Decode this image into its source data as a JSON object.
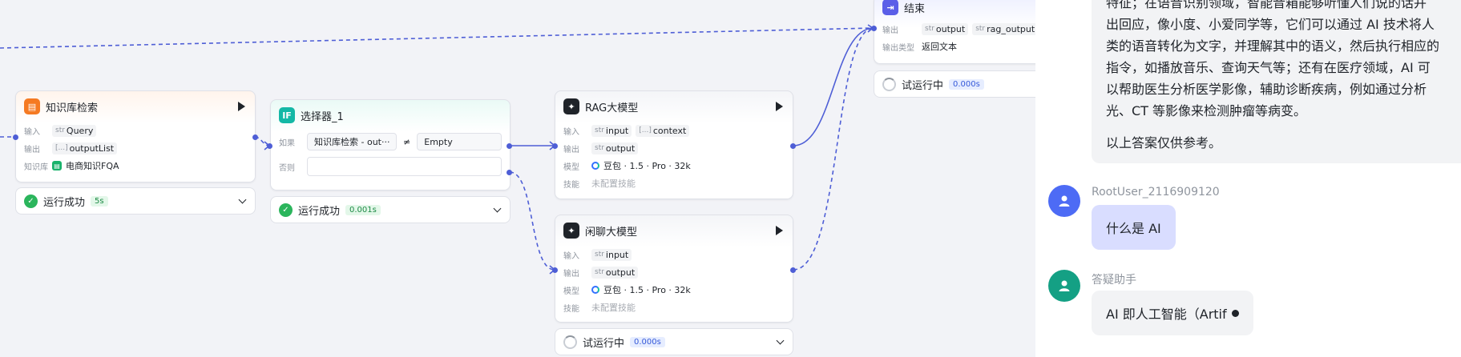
{
  "colors": {
    "edge": "#4e5ed6",
    "success": "#2bb55c",
    "accent": "#3370ff",
    "user_bubble": "#d9ddff"
  },
  "nodes": {
    "kb_search": {
      "title": "知识库检索",
      "input_label": "输入",
      "input_type": "str",
      "input_var": "Query",
      "output_label": "输出",
      "output_type": "[...]",
      "output_var": "outputList",
      "kb_label": "知识库",
      "kb_name": "电商知识FQA",
      "status_text": "运行成功",
      "status_time": "5s"
    },
    "selector": {
      "title": "选择器_1",
      "if_label": "如果",
      "cond_left": "知识库检索 - out···",
      "cond_op": "≠",
      "cond_right": "Empty",
      "else_label": "否则",
      "status_text": "运行成功",
      "status_time": "0.001s"
    },
    "rag_llm": {
      "title": "RAG大模型",
      "input_label": "输入",
      "input_type": "str",
      "input_var": "input",
      "input2_type": "[...]",
      "input2_var": "context",
      "output_label": "输出",
      "output_type": "str",
      "output_var": "output",
      "model_label": "模型",
      "model_name": "豆包 · 1.5 · Pro · 32k",
      "skill_label": "技能",
      "skill_value": "未配置技能"
    },
    "chat_llm": {
      "title": "闲聊大模型",
      "input_label": "输入",
      "input_type": "str",
      "input_var": "input",
      "output_label": "输出",
      "output_type": "str",
      "output_var": "output",
      "model_label": "模型",
      "model_name": "豆包 · 1.5 · Pro · 32k",
      "skill_label": "技能",
      "skill_value": "未配置技能",
      "status_text": "试运行中",
      "status_time": "0.000s"
    },
    "end": {
      "title": "结束",
      "output_label": "输出",
      "output_type": "str",
      "output_var": "output",
      "output2_type": "str",
      "output2_var": "rag_output",
      "otype_label": "输出类型",
      "otype_value": "返回文本",
      "status_text": "试运行中",
      "status_time": "0.000s"
    }
  },
  "chat": {
    "answer_lines": [
      "特征；在语音识别领域，智能音箱能够听懂人们说的话并",
      "出回应，像小度、小爱同学等，它们可以通过 AI 技术将人",
      "类的语音转化为文字，并理解其中的语义，然后执行相应的",
      "指令，如播放音乐、查询天气等；还有在医疗领域，AI 可",
      "以帮助医生分析医学影像，辅助诊断疾病，例如通过分析",
      "光、CT 等影像来检测肿瘤等病变。"
    ],
    "answer_footer": "以上答案仅供参考。",
    "user_name": "RootUser_2116909120",
    "user_message": "什么是 AI",
    "bot_name": "答疑助手",
    "bot_message": "AI 即人工智能（Artif"
  }
}
